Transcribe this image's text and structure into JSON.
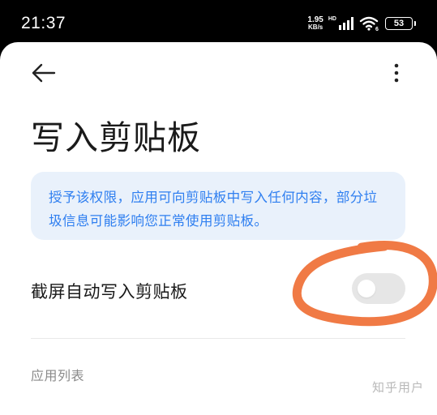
{
  "status_bar": {
    "time": "21:37",
    "net_speed_value": "1.95",
    "net_speed_unit": "KB/s",
    "signal_label": "HD",
    "wifi_badge": "6",
    "battery": "53"
  },
  "header": {
    "back_icon": "arrow-left-icon",
    "more_icon": "more-vertical-icon",
    "title": "写入剪贴板"
  },
  "notice": {
    "text": "授予该权限，应用可向剪贴板中写入任何内容，部分垃圾信息可能影响您正常使用剪贴板。"
  },
  "settings": [
    {
      "label": "截屏自动写入剪贴板",
      "enabled": false
    }
  ],
  "section": {
    "title": "应用列表"
  },
  "watermark": "知乎用户",
  "colors": {
    "notice_bg": "#e9f1fb",
    "notice_text": "#2f7ff0",
    "toggle_off": "#e6e6e6",
    "annotation_circle": "#f07a45"
  }
}
